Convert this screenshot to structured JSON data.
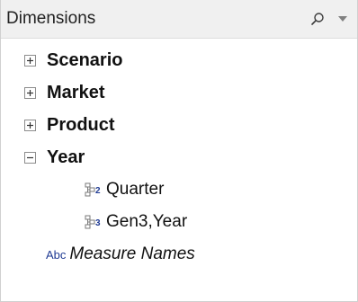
{
  "header": {
    "title": "Dimensions",
    "search_icon": "search-icon",
    "menu_icon": "dropdown-arrow-icon"
  },
  "tree": {
    "nodes": [
      {
        "label": "Scenario",
        "state": "collapsed",
        "icon": "plus-box-icon"
      },
      {
        "label": "Market",
        "state": "collapsed",
        "icon": "plus-box-icon"
      },
      {
        "label": "Product",
        "state": "collapsed",
        "icon": "plus-box-icon"
      },
      {
        "label": "Year",
        "state": "expanded",
        "icon": "minus-box-icon"
      }
    ],
    "year_children": [
      {
        "label": "Quarter",
        "badge": "2",
        "icon": "hierarchy-level-icon"
      },
      {
        "label": "Gen3,Year",
        "badge": "3",
        "icon": "hierarchy-level-icon"
      }
    ],
    "measure": {
      "abc": "Abc",
      "label": "Measure Names",
      "icon": "abc-text-icon"
    }
  },
  "colors": {
    "header_bg": "#f0f0f0",
    "badge": "#1f3a93",
    "hier_grey": "#7a7a7a",
    "abc_blue": "#1f3a93"
  }
}
